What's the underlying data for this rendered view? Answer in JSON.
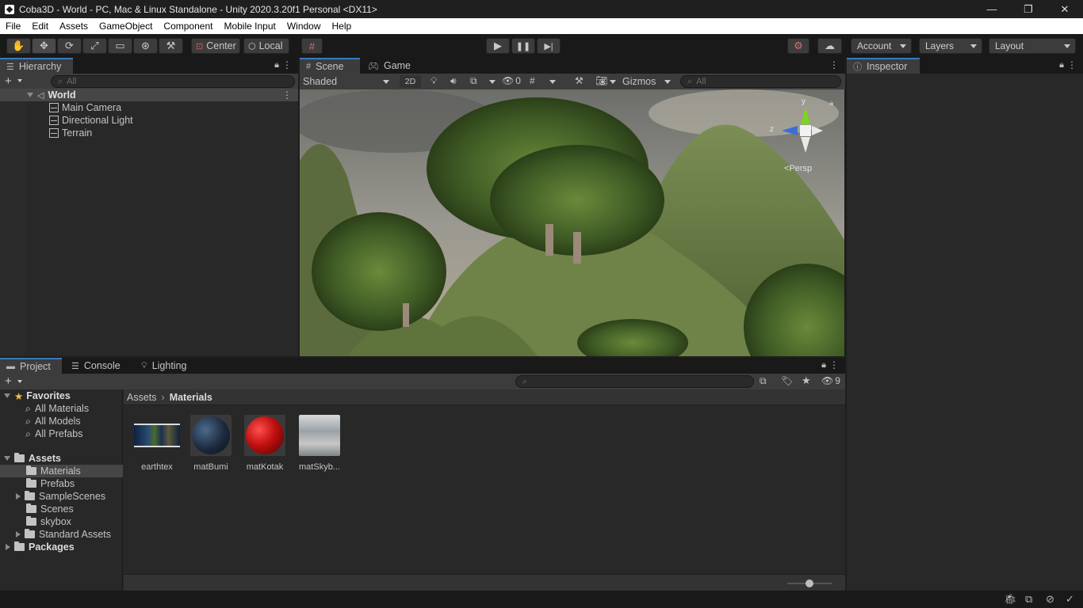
{
  "window": {
    "title": "Coba3D - World - PC, Mac & Linux Standalone - Unity 2020.3.20f1 Personal <DX11>",
    "minimize": "—",
    "maximize": "❐",
    "close": "✕"
  },
  "menu": [
    "File",
    "Edit",
    "Assets",
    "GameObject",
    "Component",
    "Mobile Input",
    "Window",
    "Help"
  ],
  "toolbar": {
    "tools": [
      "hand-tool",
      "move-tool",
      "rotate-tool",
      "scale-tool",
      "rect-tool",
      "transform-tool",
      "custom-tool"
    ],
    "pivot_label": "Center",
    "space_label": "Local",
    "account_label": "Account",
    "layers_label": "Layers",
    "layout_label": "Layout"
  },
  "hierarchy": {
    "tab_label": "Hierarchy",
    "search_placeholder": "All",
    "scene_name": "World",
    "objects": [
      "Main Camera",
      "Directional Light",
      "Terrain"
    ]
  },
  "scene": {
    "tabs": [
      "Scene",
      "Game"
    ],
    "shading_mode": "Shaded",
    "mode_2d": "2D",
    "hidden_count": "0",
    "gizmos_label": "Gizmos",
    "search_placeholder": "All",
    "projection_label": "Persp",
    "axis_y": "y",
    "axis_z": "z"
  },
  "inspector": {
    "tab_label": "Inspector"
  },
  "project": {
    "tabs": [
      "Project",
      "Console",
      "Lighting"
    ],
    "favorites_label": "Favorites",
    "favorites": [
      "All Materials",
      "All Models",
      "All Prefabs"
    ],
    "assets_label": "Assets",
    "folders": [
      "Materials",
      "Prefabs",
      "SampleScenes",
      "Scenes",
      "skybox",
      "Standard Assets"
    ],
    "packages_label": "Packages",
    "breadcrumb_root": "Assets",
    "breadcrumb_current": "Materials",
    "hidden_count": "9",
    "items": [
      "earthtex",
      "matBumi",
      "matKotak",
      "matSkyb..."
    ]
  }
}
